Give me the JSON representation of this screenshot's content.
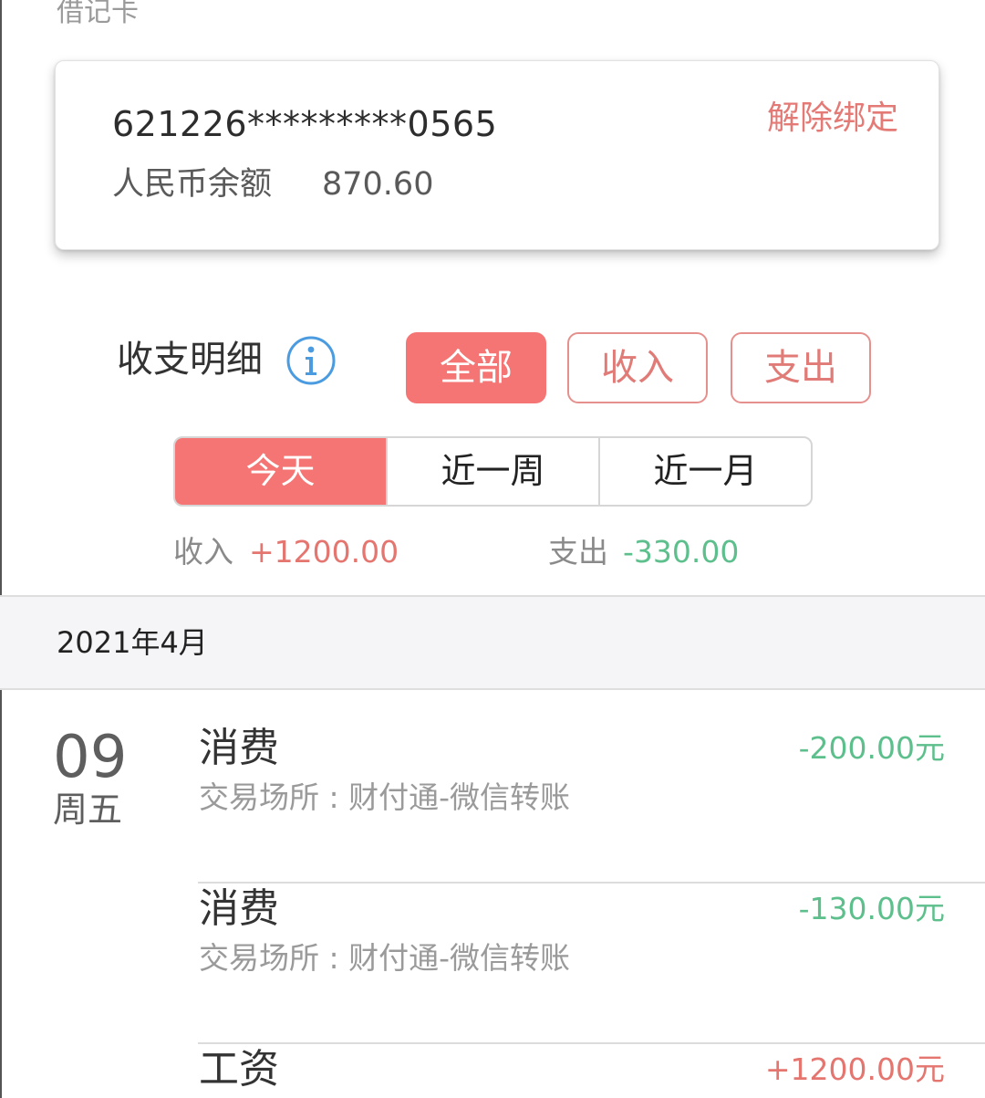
{
  "section": {
    "label": "借记卡"
  },
  "card": {
    "number": "621226*********0565",
    "unbind_label": "解除绑定",
    "balance_label": "人民币余额",
    "balance_value": "870.60"
  },
  "details": {
    "title": "收支明细",
    "type_buttons": [
      "全部",
      "收入",
      "支出"
    ],
    "active_type": "全部",
    "period_tabs": [
      "今天",
      "近一周",
      "近一月"
    ],
    "active_period": "今天"
  },
  "summary": {
    "income_label": "收入",
    "income_value": "+1200.00",
    "expense_label": "支出",
    "expense_value": "-330.00"
  },
  "month": {
    "label": "2021年4月"
  },
  "day": {
    "number": "09",
    "weekday": "周五"
  },
  "transactions": [
    {
      "title": "消费",
      "subtitle": "交易场所 : 财付通-微信转账",
      "amount": "-200.00元",
      "type": "expense"
    },
    {
      "title": "消费",
      "subtitle": "交易场所 : 财付通-微信转账",
      "amount": "-130.00元",
      "type": "expense"
    },
    {
      "title": "工资",
      "subtitle": "",
      "amount": "+1200.00元",
      "type": "income"
    }
  ],
  "colors": {
    "accent": "#f47574",
    "unbind_text": "#e47a75",
    "income": "#e4756f",
    "expense": "#5cbf8c",
    "info_icon": "#4a9be0"
  },
  "icons": {
    "info": "info-circle-icon"
  }
}
